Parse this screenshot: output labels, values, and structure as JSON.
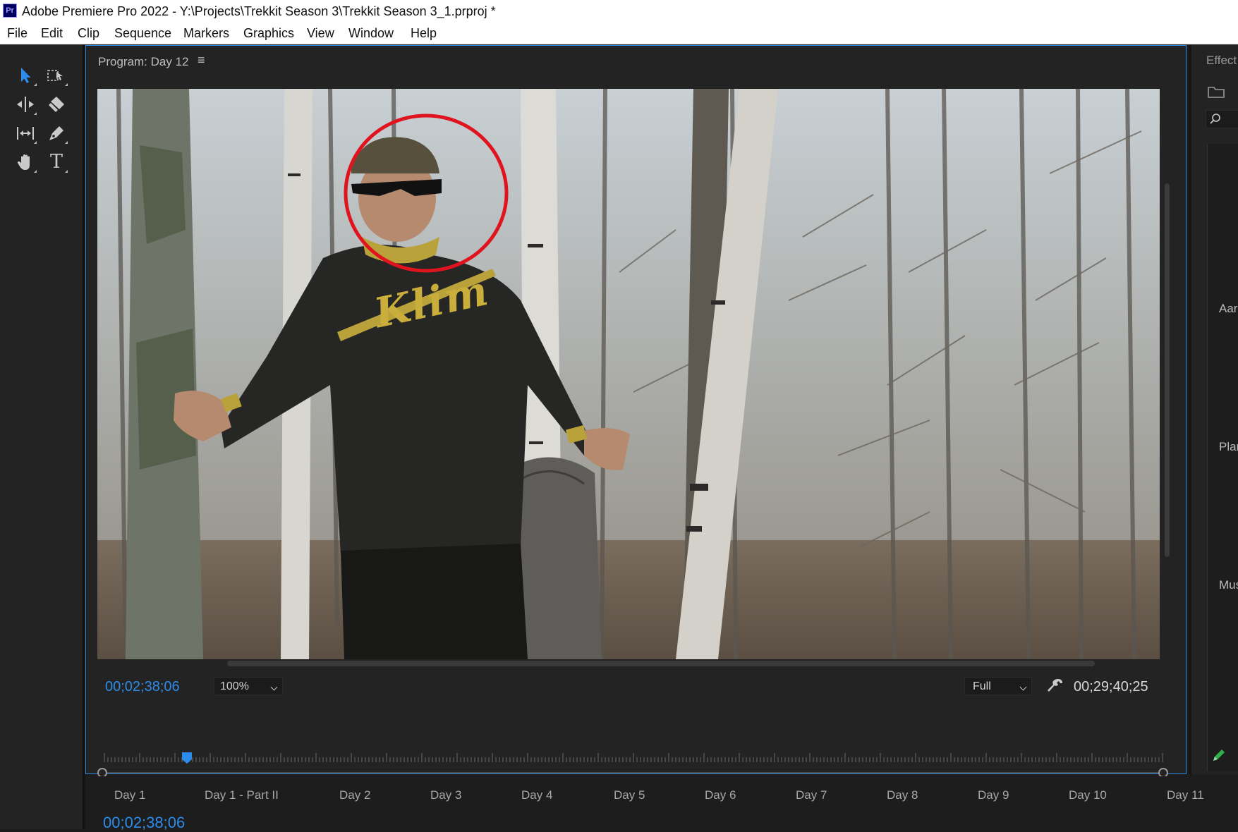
{
  "window": {
    "app_icon_label": "Pr",
    "title": "Adobe Premiere Pro 2022 - Y:\\Projects\\Trekkit Season 3\\Trekkit Season 3_1.prproj *"
  },
  "menu": [
    "File",
    "Edit",
    "Clip",
    "Sequence",
    "Markers",
    "Graphics",
    "View",
    "Window",
    "Help"
  ],
  "tools": [
    {
      "name": "selection-tool",
      "icon": "arrow-icon",
      "active": true
    },
    {
      "name": "track-select-forward-tool",
      "icon": "track-select-icon"
    },
    {
      "name": "ripple-edit-tool",
      "icon": "ripple-edit-icon"
    },
    {
      "name": "razor-tool",
      "icon": "razor-icon"
    },
    {
      "name": "slip-tool",
      "icon": "slip-icon"
    },
    {
      "name": "pen-tool",
      "icon": "pen-icon"
    },
    {
      "name": "hand-tool",
      "icon": "hand-icon"
    },
    {
      "name": "type-tool",
      "icon": "type-icon",
      "glyph": "T"
    }
  ],
  "monitor": {
    "title": "Program: Day 12",
    "menu_glyph": "≡",
    "jersey_text": "Klim",
    "current_timecode": "00;02;38;06",
    "zoom": "100%",
    "resolution": "Full",
    "duration_timecode": "00;29;40;25",
    "playhead_position": 0.078,
    "colors": {
      "accent": "#2d8ceb",
      "annotation_circle": "#e0141e"
    }
  },
  "transport": [
    {
      "name": "add-marker-button",
      "icon": "marker-icon"
    },
    {
      "name": "mark-in-button",
      "icon": "mark-in-icon"
    },
    {
      "name": "mark-out-button",
      "icon": "mark-out-icon"
    },
    {
      "name": "go-to-in-button",
      "icon": "go-to-in-icon"
    },
    {
      "name": "step-back-button",
      "icon": "step-back-icon"
    },
    {
      "name": "play-button",
      "icon": "play-icon"
    },
    {
      "name": "step-forward-button",
      "icon": "step-forward-icon"
    },
    {
      "name": "go-to-out-button",
      "icon": "go-to-out-icon"
    },
    {
      "name": "lift-button",
      "icon": "lift-icon"
    },
    {
      "name": "extract-button",
      "icon": "extract-icon"
    },
    {
      "name": "export-frame-button",
      "icon": "camera-icon"
    },
    {
      "name": "comparison-view-button",
      "icon": "comparison-icon"
    },
    {
      "name": "multi-camera-button",
      "icon": "multicam-icon"
    },
    {
      "name": "button-editor-button",
      "icon": "plus-icon"
    }
  ],
  "right_panel": {
    "title": "Effect C",
    "items": [
      "Aarc",
      "Plan",
      "Mus"
    ]
  },
  "sequence_tabs": [
    "Day 1",
    "Day 1 - Part II",
    "Day 2",
    "Day 3",
    "Day 4",
    "Day 5",
    "Day 6",
    "Day 7",
    "Day 8",
    "Day 9",
    "Day 10",
    "Day 11"
  ],
  "timeline_timecode": "00;02;38;06"
}
